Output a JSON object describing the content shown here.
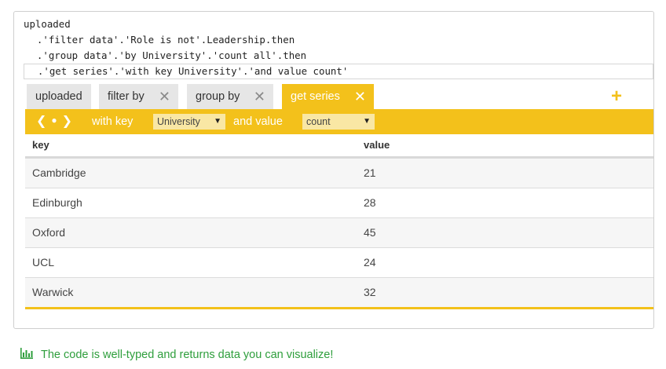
{
  "code": {
    "lines": [
      "uploaded",
      "  .'filter data'.'Role is not'.Leadership.then",
      "  .'group data'.'by University'.'count all'.then",
      "  .'get series'.'with key University'.'and value count'"
    ]
  },
  "tabs": [
    {
      "label": "uploaded",
      "closable": false,
      "active": false
    },
    {
      "label": "filter by",
      "closable": true,
      "active": false
    },
    {
      "label": "group by",
      "closable": true,
      "active": false
    },
    {
      "label": "get series",
      "closable": true,
      "active": true
    }
  ],
  "close_glyph": "✕",
  "add_glyph": "+",
  "toolbar": {
    "nav_prev": "❮",
    "nav_dot": "●",
    "nav_next": "❯",
    "with_key_label": "with key",
    "key_select_value": "University",
    "and_value_label": "and value",
    "value_select_value": "count",
    "caret": "▼"
  },
  "table": {
    "columns": [
      "key",
      "value"
    ],
    "rows": [
      [
        "Cambridge",
        "21"
      ],
      [
        "Edinburgh",
        "28"
      ],
      [
        "Oxford",
        "45"
      ],
      [
        "UCL",
        "24"
      ],
      [
        "Warwick",
        "32"
      ]
    ]
  },
  "status": {
    "icon": "bar-chart-icon",
    "message": "The code is well-typed and returns data you can visualize!"
  },
  "colors": {
    "accent": "#f3c11b",
    "success": "#2e9e3c",
    "tab_inactive": "#e6e6e6"
  }
}
